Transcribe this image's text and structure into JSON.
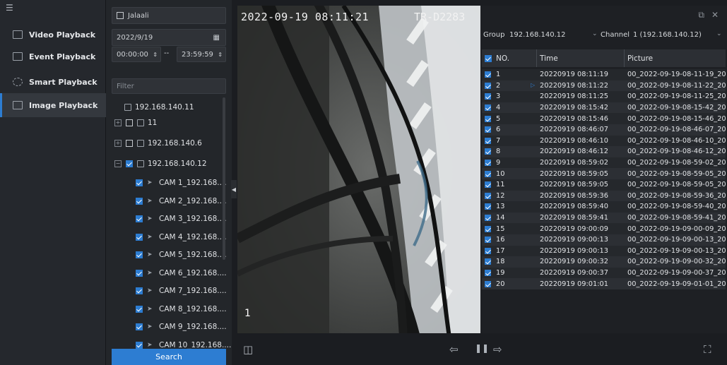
{
  "nav": {
    "items": [
      {
        "label": "Video Playback",
        "icon": "video-playback-icon"
      },
      {
        "label": "Event Playback",
        "icon": "event-playback-icon"
      },
      {
        "label": "Smart Playback",
        "icon": "smart-playback-icon"
      },
      {
        "label": "Image Playback",
        "icon": "image-playback-icon",
        "active": true
      }
    ]
  },
  "filters": {
    "device": "Jalaali",
    "date": "2022/9/19",
    "time_from": "00:00:00",
    "time_sep": "--",
    "time_to": "23:59:59",
    "filter_placeholder": "Filter"
  },
  "tree": {
    "root": "192.168.140.11",
    "groups": [
      {
        "name": "11",
        "checked": false
      },
      {
        "name": "192.168.140.6",
        "checked": false
      },
      {
        "name": "192.168.140.12",
        "checked": true
      }
    ],
    "cameras": [
      "CAM 1_192.168....",
      "CAM 2_192.168....",
      "CAM 3_192.168....",
      "CAM 4_192.168....",
      "CAM 5_192.168....",
      "CAM 6_192.168....",
      "CAM 7_192.168....",
      "CAM 8_192.168....",
      "CAM 9_192.168....",
      "CAM 10_192.168...."
    ]
  },
  "search_label": "Search",
  "video": {
    "osd_time": "2022-09-19 08:11:21",
    "osd_name": "TR-D2283",
    "channel_no": "1"
  },
  "right": {
    "group_label": "Group",
    "group_value": "192.168.140.12",
    "channel_label": "Channel",
    "channel_value": "1 (192.168.140.12)",
    "columns": [
      "NO.",
      "Time",
      "Picture"
    ],
    "rows": [
      {
        "no": "1",
        "time": "20220919 08:11:19",
        "pic": "00_2022-09-19-08-11-19_20"
      },
      {
        "no": "2",
        "time": "20220919 08:11:22",
        "pic": "00_2022-09-19-08-11-22_20"
      },
      {
        "no": "3",
        "time": "20220919 08:11:25",
        "pic": "00_2022-09-19-08-11-25_20"
      },
      {
        "no": "4",
        "time": "20220919 08:15:42",
        "pic": "00_2022-09-19-08-15-42_20"
      },
      {
        "no": "5",
        "time": "20220919 08:15:46",
        "pic": "00_2022-09-19-08-15-46_20"
      },
      {
        "no": "6",
        "time": "20220919 08:46:07",
        "pic": "00_2022-09-19-08-46-07_20"
      },
      {
        "no": "7",
        "time": "20220919 08:46:10",
        "pic": "00_2022-09-19-08-46-10_20"
      },
      {
        "no": "8",
        "time": "20220919 08:46:12",
        "pic": "00_2022-09-19-08-46-12_20"
      },
      {
        "no": "9",
        "time": "20220919 08:59:02",
        "pic": "00_2022-09-19-08-59-02_20"
      },
      {
        "no": "10",
        "time": "20220919 08:59:05",
        "pic": "00_2022-09-19-08-59-05_20"
      },
      {
        "no": "11",
        "time": "20220919 08:59:05",
        "pic": "00_2022-09-19-08-59-05_20"
      },
      {
        "no": "12",
        "time": "20220919 08:59:36",
        "pic": "00_2022-09-19-08-59-36_20"
      },
      {
        "no": "13",
        "time": "20220919 08:59:40",
        "pic": "00_2022-09-19-08-59-40_20"
      },
      {
        "no": "14",
        "time": "20220919 08:59:41",
        "pic": "00_2022-09-19-08-59-41_20"
      },
      {
        "no": "15",
        "time": "20220919 09:00:09",
        "pic": "00_2022-09-19-09-00-09_20"
      },
      {
        "no": "16",
        "time": "20220919 09:00:13",
        "pic": "00_2022-09-19-09-00-13_20"
      },
      {
        "no": "17",
        "time": "20220919 09:00:13",
        "pic": "00_2022-09-19-09-00-13_20"
      },
      {
        "no": "18",
        "time": "20220919 09:00:32",
        "pic": "00_2022-09-19-09-00-32_20"
      },
      {
        "no": "19",
        "time": "20220919 09:00:37",
        "pic": "00_2022-09-19-09-00-37_20"
      },
      {
        "no": "20",
        "time": "20220919 09:01:01",
        "pic": "00_2022-09-19-09-01-01_20"
      }
    ]
  },
  "colors": {
    "accent": "#2d7dd2",
    "background": "#1b1d21",
    "panel": "#23262a"
  }
}
